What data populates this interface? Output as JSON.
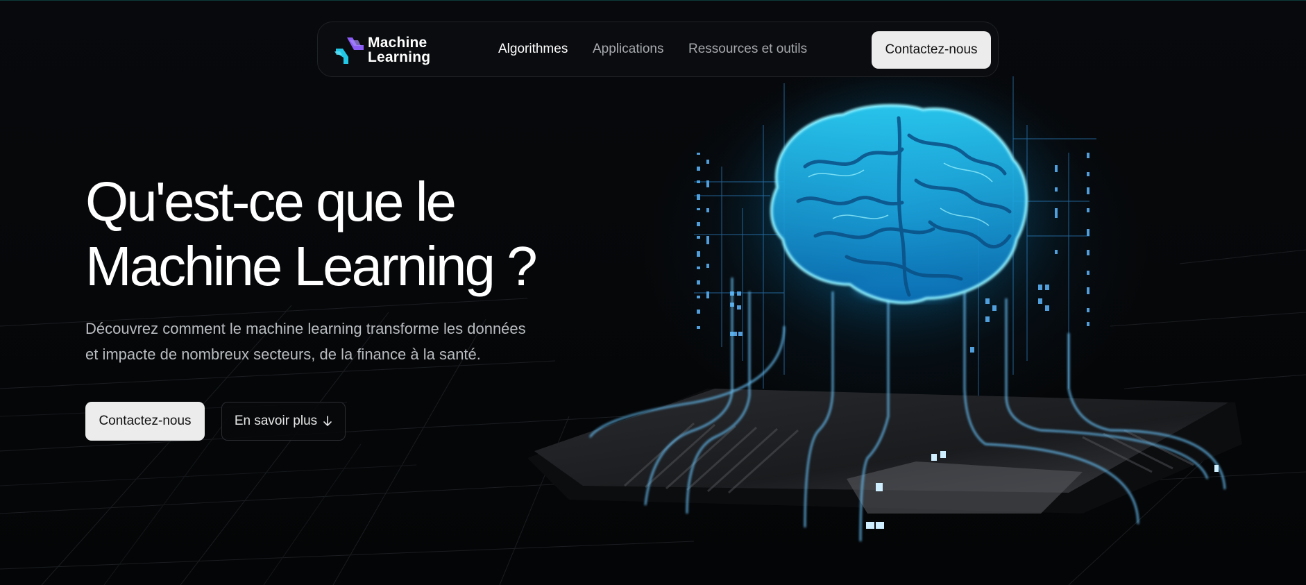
{
  "brand": {
    "line1": "Machine",
    "line2": "Learning",
    "logo_icon": "machine-learning-logo-icon",
    "colors": {
      "cyan": "#22c7e6",
      "purple": "#8b5cf6"
    }
  },
  "nav": {
    "links": [
      {
        "label": "Algorithmes",
        "active": true
      },
      {
        "label": "Applications",
        "active": false
      },
      {
        "label": "Ressources et outils",
        "active": false
      }
    ],
    "cta_label": "Contactez-nous"
  },
  "hero": {
    "title_line1": "Qu'est-ce que le",
    "title_line2": "Machine Learning ?",
    "subtitle_line1": "Découvrez comment le machine learning transforme les données",
    "subtitle_line2": "et impacte de nombreux secteurs, de la finance à la santé.",
    "primary_label": "Contactez-nous",
    "secondary_label": "En savoir plus",
    "secondary_icon": "arrow-down-icon"
  },
  "illustration": {
    "icon": "glowing-brain-on-chip-illustration",
    "accent": "#29c9ff"
  }
}
